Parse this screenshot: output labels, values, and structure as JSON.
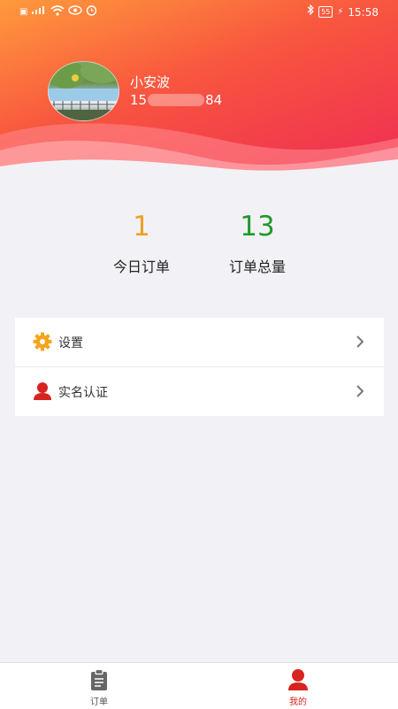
{
  "status_bar": {
    "left_icons": [
      "hd-icon",
      "4g-signal-icon",
      "wifi-icon",
      "eye-icon",
      "alarm-icon"
    ],
    "battery": "55",
    "time": "15:58"
  },
  "profile": {
    "name": "小安波",
    "phone_prefix": "15",
    "phone_suffix": "84"
  },
  "stats": {
    "today_orders_value": "1",
    "today_orders_label": "今日订单",
    "total_orders_value": "13",
    "total_orders_label": "订单总量"
  },
  "menu": {
    "settings_label": "设置",
    "verification_label": "实名认证"
  },
  "tabbar": {
    "orders_label": "订单",
    "mine_label": "我的"
  },
  "colors": {
    "header_gradient": [
      "#ff9a3c",
      "#f8553f",
      "#ef2c54"
    ],
    "today_value": "#f0a020",
    "total_value": "#1f9a2a",
    "active_tab": "#d8231e"
  }
}
